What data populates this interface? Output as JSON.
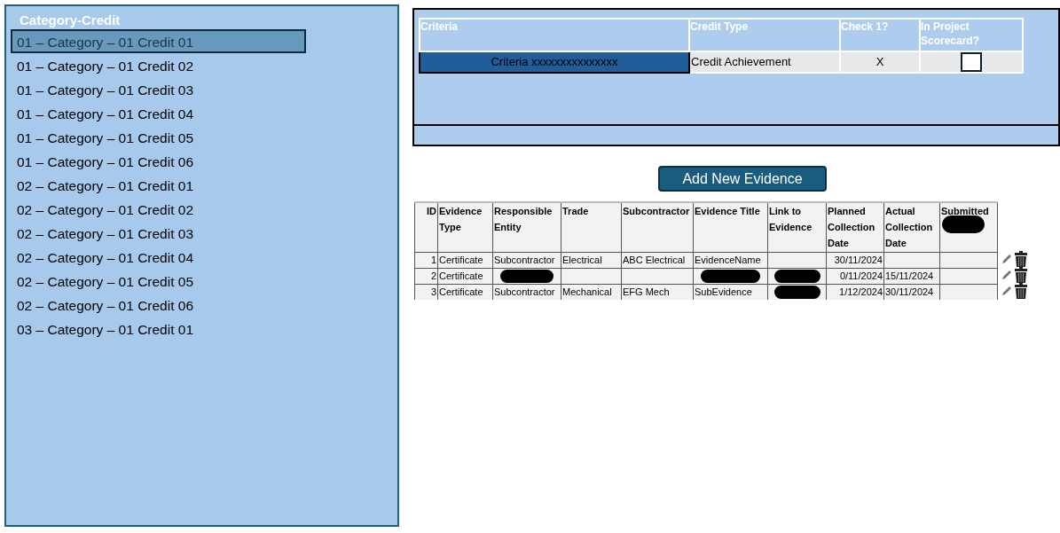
{
  "sidebar": {
    "title": "Category-Credit",
    "items": [
      {
        "label": "01 – Category – 01 Credit 01",
        "selected": true
      },
      {
        "label": "01 – Category – 01 Credit 02",
        "selected": false
      },
      {
        "label": "01 – Category – 01 Credit 03",
        "selected": false
      },
      {
        "label": "01 – Category – 01 Credit 04",
        "selected": false
      },
      {
        "label": "01 – Category – 01 Credit 05",
        "selected": false
      },
      {
        "label": "01 – Category – 01 Credit 06",
        "selected": false
      },
      {
        "label": "02 – Category – 01 Credit 01",
        "selected": false
      },
      {
        "label": "02 – Category – 01 Credit 02",
        "selected": false
      },
      {
        "label": "02 – Category – 01 Credit 03",
        "selected": false
      },
      {
        "label": "02 – Category – 01 Credit 04",
        "selected": false
      },
      {
        "label": "02 – Category – 01 Credit 05",
        "selected": false
      },
      {
        "label": "02 – Category – 01 Credit 06",
        "selected": false
      },
      {
        "label": "03 – Category – 01 Credit 01",
        "selected": false
      }
    ]
  },
  "criteria_table": {
    "columns": [
      "Criteria",
      "Credit Type",
      "Check 1?",
      "In Project Scorecard?"
    ],
    "rows": [
      {
        "criteria": "Criteria xxxxxxxxxxxxxxx",
        "credit_type": "Credit Achievement",
        "check": "X",
        "in_scorecard": false
      }
    ]
  },
  "add_button": "Add New Evidence",
  "evidence_table": {
    "columns": [
      "ID",
      "Evidence Type",
      "Responsible Entity",
      "Trade",
      "Subcontractor",
      "Evidence Title",
      "Link to Evidence",
      "Planned Collection Date",
      "Actual Collection Date",
      "Submitted"
    ],
    "header_redacted": [
      false,
      false,
      false,
      false,
      false,
      false,
      false,
      false,
      false,
      true
    ],
    "rows": [
      {
        "cells": [
          "1",
          "Certificate",
          "Subcontractor",
          "Electrical",
          "ABC Electrical",
          "EvidenceName",
          "",
          "30/11/2024",
          "",
          ""
        ],
        "redacted": [
          false,
          false,
          false,
          false,
          false,
          false,
          false,
          false,
          false,
          false
        ]
      },
      {
        "cells": [
          "2",
          "Certificate",
          "",
          "",
          "",
          "",
          "",
          "0/11/2024",
          "15/11/2024",
          ""
        ],
        "redacted": [
          false,
          false,
          true,
          false,
          false,
          true,
          true,
          false,
          false,
          false
        ]
      },
      {
        "cells": [
          "3",
          "Certificate",
          "Subcontractor",
          "Mechanical",
          "EFG Mech",
          "SubEvidence",
          "",
          "1/12/2024",
          "30/11/2024",
          ""
        ],
        "redacted": [
          false,
          false,
          false,
          false,
          false,
          false,
          true,
          false,
          false,
          false
        ]
      }
    ]
  }
}
